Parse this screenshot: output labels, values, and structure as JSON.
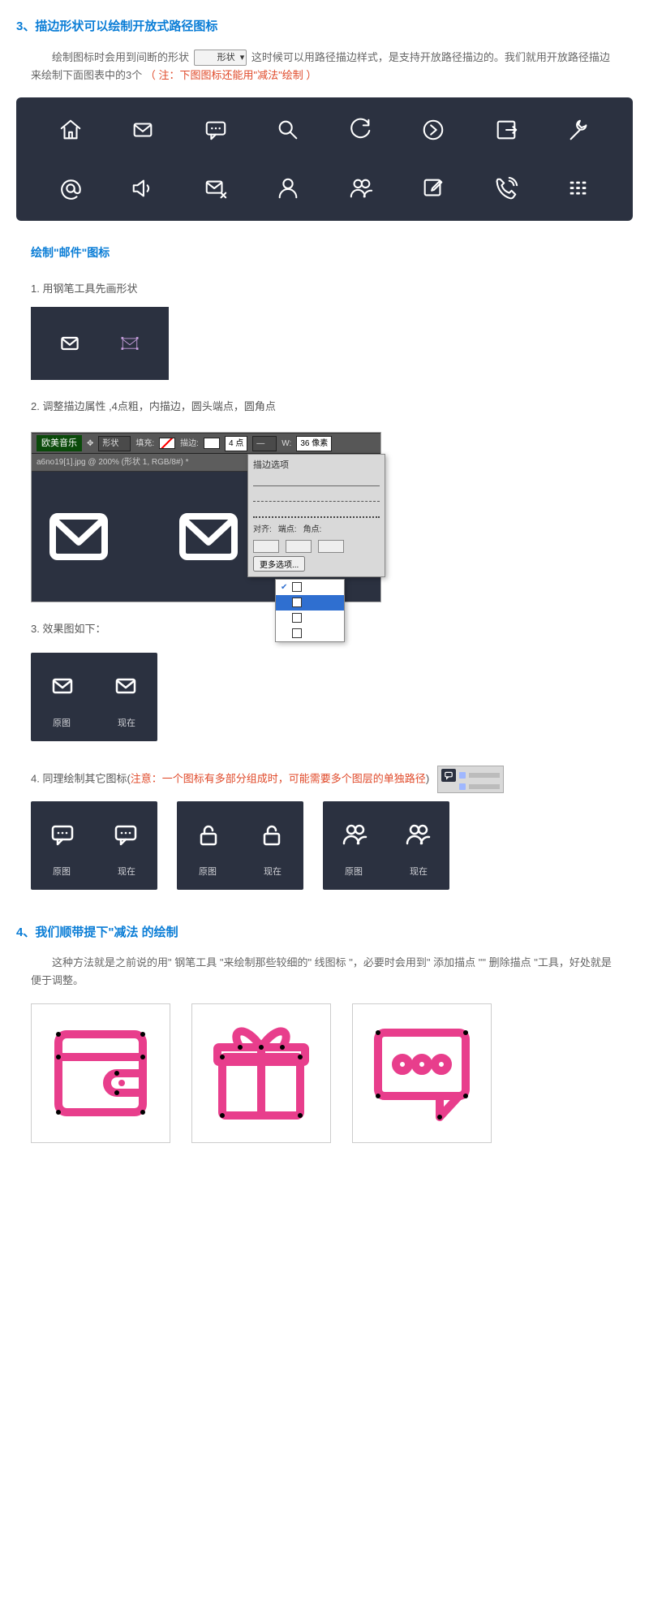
{
  "section3": {
    "title": "3、描边形状可以绘制开放式路径图标",
    "para_pre": "绘制图标时会用到间断的形状",
    "dropdown": "形状",
    "para_post": "这时候可以用路径描边样式，是支持开放路径描边的。我们就用开放路径描边来绘制下面图表中的3个",
    "note": "（ 注：下图图标还能用\"减法\"绘制 ）"
  },
  "icons": {
    "row1": [
      "home-icon",
      "mail-icon",
      "chat-icon",
      "search-icon",
      "refresh-icon",
      "progress-icon",
      "exit-icon",
      "wrench-icon"
    ],
    "row2": [
      "at-icon",
      "volume-icon",
      "mail-x-icon",
      "user-icon",
      "users-icon",
      "edit-icon",
      "phone-icon",
      "keypad-icon"
    ]
  },
  "mail_section": {
    "title": "绘制\"邮件\"图标",
    "step1": "1. 用钢笔工具先画形状",
    "step2": "2. 调整描边属性 ,4点粗，内描边，圆头端点，圆角点",
    "step3": "3. 效果图如下：",
    "step4_pre": "4. 同理绘制其它图标(",
    "step4_note": "注意：一个图标有多部分组成时，可能需要多个图层的单独路径",
    "step4_post": ")"
  },
  "ps": {
    "tab_music": "欧美音乐",
    "mode_label": "形状",
    "fill_label": "填充:",
    "stroke_label": "描边:",
    "stroke_val": "4 点",
    "w_label": "W:",
    "w_val": "36 像素",
    "doc_tab": "a6no19[1].jpg @ 200% (形状 1, RGB/8#) *",
    "pop_title": "描边选项",
    "align": "对齐:",
    "cap": "端点:",
    "corner": "角点:",
    "more": "更多选项..."
  },
  "labels": {
    "orig": "原图",
    "now": "现在"
  },
  "section4": {
    "title": "4、我们顺带提下\"减法 的绘制",
    "para": "这种方法就是之前说的用\" 钢笔工具 \"来绘制那些较细的\" 线图标 \"，必要时会用到\" 添加描点 \"\" 删除描点 \"工具，好处就是便于调整。"
  }
}
